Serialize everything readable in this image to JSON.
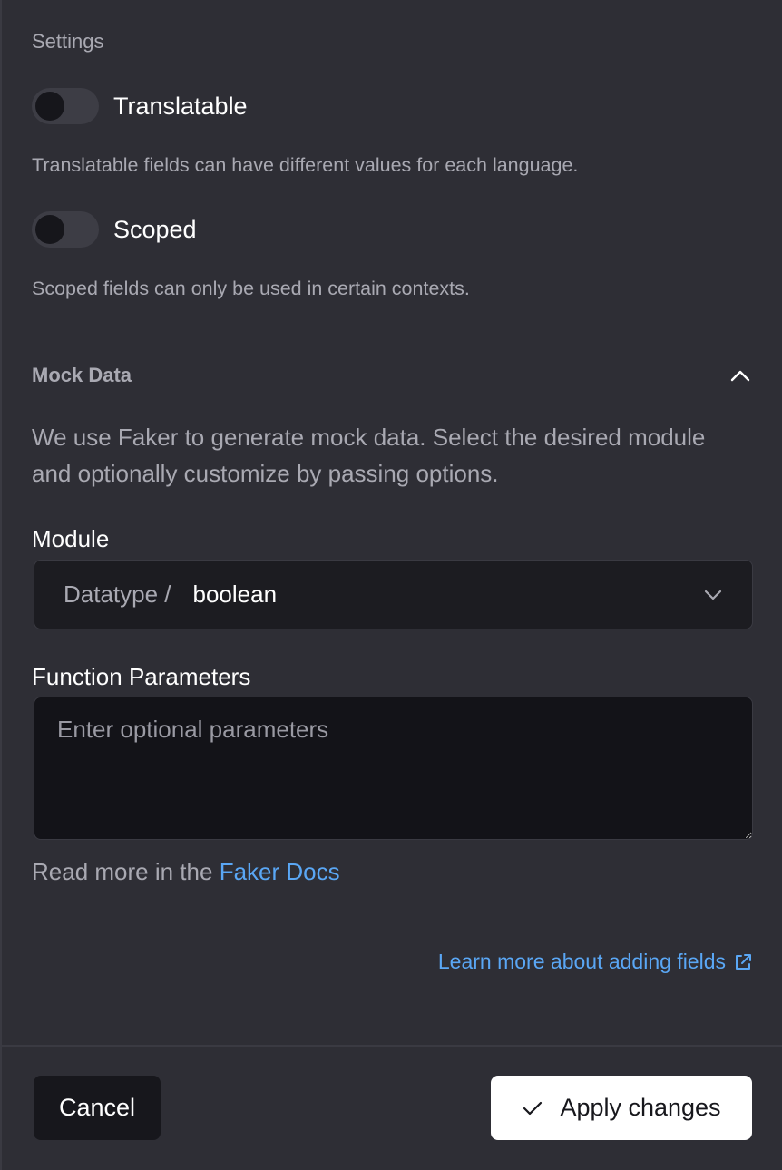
{
  "settings": {
    "label": "Settings",
    "translatable": {
      "label": "Translatable",
      "enabled": false,
      "help": "Translatable fields can have different values for each language."
    },
    "scoped": {
      "label": "Scoped",
      "enabled": false,
      "help": "Scoped fields can only be used in certain contexts."
    }
  },
  "mock_data": {
    "title": "Mock Data",
    "expanded": true,
    "description": "We use Faker to generate mock data. Select the desired module and optionally customize by passing options.",
    "module": {
      "label": "Module",
      "prefix": "Datatype /",
      "value": "boolean"
    },
    "parameters": {
      "label": "Function Parameters",
      "placeholder": "Enter optional parameters",
      "value": ""
    },
    "read_more_prefix": "Read more in the",
    "docs_link": "Faker Docs"
  },
  "learn_more": "Learn more about adding fields",
  "footer": {
    "cancel": "Cancel",
    "apply": "Apply changes"
  },
  "colors": {
    "background": "#2e2e35",
    "link": "#5aa7f5",
    "primary_button": "#ffffff",
    "secondary_button": "#17171c"
  },
  "icons": {
    "collapse": "chevron-up-icon",
    "select": "chevron-down-icon",
    "external": "external-link-icon",
    "apply": "check-icon"
  }
}
